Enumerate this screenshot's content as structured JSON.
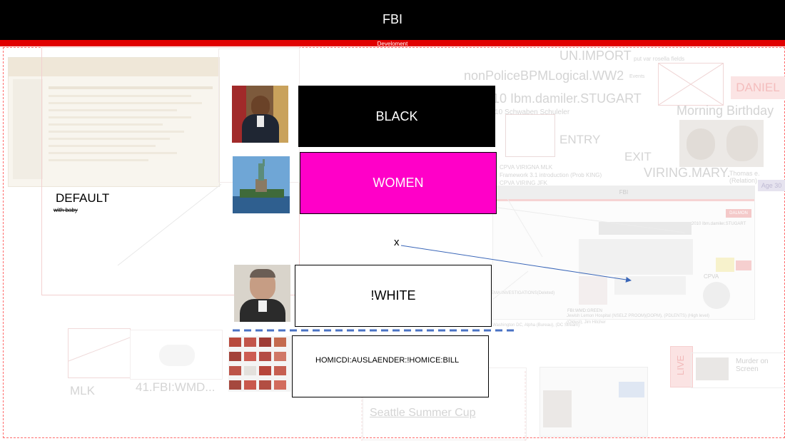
{
  "header": {
    "title": "FBI"
  },
  "subheader": {
    "label": "Develoment"
  },
  "faded": {
    "un_import": "UN.IMPORT",
    "un_import_note": "put var rosella fields",
    "nonpolice": "nonPoliceBPMLogical.WW2",
    "nonpolice_note": "Events",
    "ibm": "2010 Ibm.damiler.STUGART",
    "ibm_note": "2010 Schwaben Schuleler",
    "daniel": "DANIEL",
    "morning": "Morning Birthday",
    "entry": "ENTRY",
    "exit": "EXIT",
    "viring": "VIRING.MARY.",
    "viring_note": "Thomas e. (Relation)",
    "age": "Age 30",
    "cpva1": "CPVA VIRIGNA MLK",
    "cpva2": "Framework 3.1 introduction (Prob KING)",
    "cpva3": "CPVA VIRING JFK",
    "mlk": "MLK",
    "wmd": "41.FBI:WMD...",
    "live": "LIVE",
    "murder": "Murder on Screen",
    "seattle": "Seattle Summer Cup",
    "screen_header": "FBI",
    "screen_badge": "DALMON",
    "screen_line1": "2010 Ibm.damiler.STUGART",
    "screen_cpva": "CPVA",
    "screen_wmd": "FBI:WMD:GREEN",
    "screen_wmd2": "Jewish Lemon Hospital (NSELZ PROOM)(DOPM), (PDLENTS) (High level)",
    "screen_wmd3": "(Oldest), Jim Hitcher",
    "screen_inv": "EMA:INVESTIGATIONS(Deleted)",
    "screen_dc": "Washington DC, Alpha (Bureau), (DC Stream)"
  },
  "labels": {
    "default": "DEFAULT",
    "default_note": "with baby",
    "x_mark": "x"
  },
  "rows": [
    {
      "label": "BLACK",
      "bg": "#000000",
      "fg": "#ffffff"
    },
    {
      "label": "WOMEN",
      "bg": "#ff00c8",
      "fg": "#ffffff"
    },
    {
      "label": "!WHITE",
      "bg": "#ffffff",
      "fg": "#000000"
    },
    {
      "label": "HOMICDI:AUSLAENDER:!HOMICE:BILL",
      "bg": "#ffffff",
      "fg": "#000000"
    }
  ],
  "colors": {
    "topbar": "#000000",
    "redbar": "#e00000",
    "frame": "#ff6b6b",
    "divider": "#4a72c4",
    "arrow": "#3a66b8"
  }
}
